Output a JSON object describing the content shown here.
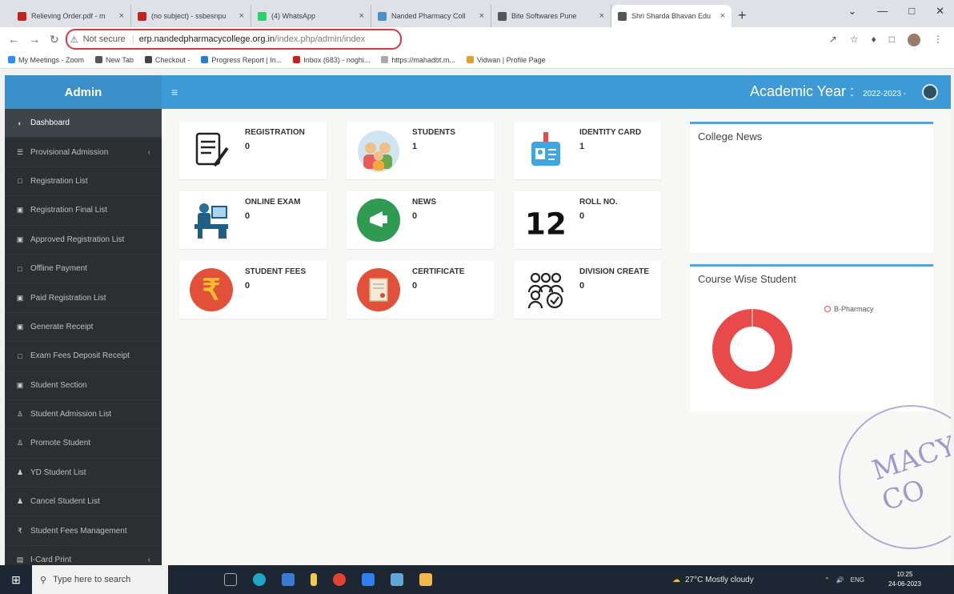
{
  "browser": {
    "tabs": [
      {
        "label": "Relieving Order.pdf - m",
        "color": "#c5221f"
      },
      {
        "label": "(no subject) - ssbesnpu",
        "color": "#c5221f"
      },
      {
        "label": "(4) WhatsApp",
        "color": "#25d366"
      },
      {
        "label": "Nanded Pharmacy Coll",
        "color": "#4a90c8"
      },
      {
        "label": "Bite Softwares Pune",
        "color": "#555555"
      },
      {
        "label": "Shri Sharda Bhavan Edu",
        "color": "#555555"
      }
    ],
    "address": {
      "not_secure": "Not secure",
      "host": "erp.nandedpharmacycollege.org.in",
      "path": "/index.php/admin/index"
    },
    "bookmarks": [
      {
        "label": "My Meetings - Zoom",
        "color": "#2d8cff"
      },
      {
        "label": "New Tab",
        "color": "#555555"
      },
      {
        "label": "Checkout -",
        "color": "#444444"
      },
      {
        "label": "Progress Report | In...",
        "color": "#2b7bd8"
      },
      {
        "label": "Inbox (683) - noghi...",
        "color": "#c5221f"
      },
      {
        "label": "https://mahadbt.m...",
        "color": "#aaaaaa"
      },
      {
        "label": "Vidwan | Profile Page",
        "color": "#e0a030"
      }
    ]
  },
  "app": {
    "brand": "Admin",
    "academic_year_label": "Academic Year :",
    "academic_year_value": "2022-2023 -",
    "accent": "#3d9ad6",
    "sidebar": [
      {
        "label": "Dashboard",
        "icon": "◐",
        "active": true
      },
      {
        "label": "Provisional Admission",
        "icon": "☰",
        "chev": "‹"
      },
      {
        "label": "Registration List",
        "icon": "□"
      },
      {
        "label": "Registration Final List",
        "icon": "▣"
      },
      {
        "label": "Approved Registration List",
        "icon": "▣"
      },
      {
        "label": "Offline Payment",
        "icon": "□"
      },
      {
        "label": "Paid Registration List",
        "icon": "▣"
      },
      {
        "label": "Generate Receipt",
        "icon": "▣"
      },
      {
        "label": "Exam Fees Deposit Receipt",
        "icon": "□"
      },
      {
        "label": "Student Section",
        "icon": "▣"
      },
      {
        "label": "Student Admission List",
        "icon": "♙"
      },
      {
        "label": "Promote Student",
        "icon": "♙"
      },
      {
        "label": "YD Student List",
        "icon": "♟"
      },
      {
        "label": "Cancel Student List",
        "icon": "♟"
      },
      {
        "label": "Student Fees Management",
        "icon": "₹"
      },
      {
        "label": "I-Card Print",
        "icon": "▤",
        "chev": "‹"
      }
    ],
    "tiles": [
      {
        "title": "REGISTRATION",
        "count": "0"
      },
      {
        "title": "STUDENTS",
        "count": "1"
      },
      {
        "title": "IDENTITY CARD",
        "count": "1"
      },
      {
        "title": "ONLINE EXAM",
        "count": "0"
      },
      {
        "title": "NEWS",
        "count": "0"
      },
      {
        "title": "ROLL NO.",
        "count": "0"
      },
      {
        "title": "STUDENT FEES",
        "count": "0"
      },
      {
        "title": "CERTIFICATE",
        "count": "0"
      },
      {
        "title": "DIVISION CREATE",
        "count": "0"
      }
    ],
    "college_news_title": "College News",
    "course_wise_title": "Course Wise Student",
    "chart_data": {
      "type": "pie",
      "categories": [
        "B-Pharmacy"
      ],
      "values": [
        1
      ],
      "colors": [
        "#e84a4a"
      ],
      "legend": "top-right"
    },
    "stamp_text": "MACY CO"
  },
  "taskbar": {
    "search_placeholder": "Type here to search",
    "weather": "27°C  Mostly cloudy",
    "lang": "ENG",
    "time": "10:25",
    "date": "24-06-2023"
  }
}
